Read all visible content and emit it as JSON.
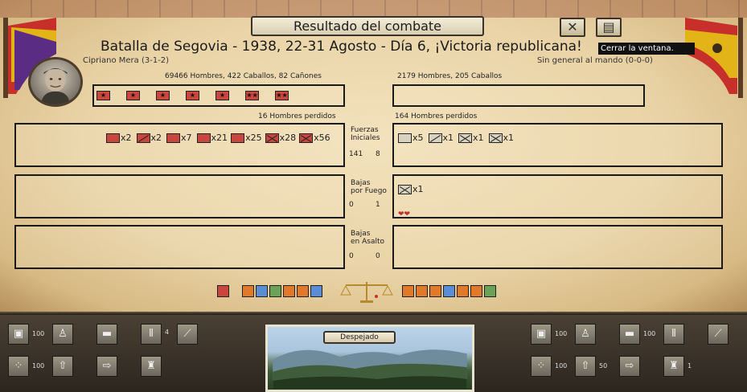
{
  "window": {
    "title": "Resultado del combate",
    "close_icon": "close-icon",
    "log_icon": "document-icon",
    "tooltip": "Cerrar la ventana."
  },
  "battle": {
    "title": "Batalla de Segovia - 1938, 22-31 Agosto - Día 6, ¡Victoria republicana!"
  },
  "left": {
    "general": "Cipriano Mera (3-1-2)",
    "strength": "69466 Hombres, 422 Caballos, 82 Cañones",
    "lost": "16 Hombres perdidos",
    "initial_units": [
      {
        "count": "x2"
      },
      {
        "count": "x2"
      },
      {
        "count": "x7"
      },
      {
        "count": "x21"
      },
      {
        "count": "x25"
      },
      {
        "count": "x28"
      },
      {
        "count": "x56"
      }
    ],
    "fire_losses": [],
    "assault_losses": [],
    "initial_stat": "141",
    "fire_stat": "0",
    "assault_stat": "0"
  },
  "right": {
    "general": "Sin general al mando (0-0-0)",
    "strength": "2179 Hombres, 205 Caballos",
    "lost": "164 Hombres perdidos",
    "initial_units": [
      {
        "count": "x5"
      },
      {
        "count": "x1"
      },
      {
        "count": "x1"
      },
      {
        "count": "x1"
      }
    ],
    "fire_losses": [
      {
        "count": "x1"
      }
    ],
    "initial_stat": "8",
    "fire_stat": "1",
    "assault_stat": "0"
  },
  "rows": {
    "initial": "Fuerzas\nIniciales",
    "fire": "Bajas\npor Fuego",
    "assault": "Bajas\nen Asalto"
  },
  "bottom": {
    "weather": "Despejado",
    "left_values": [
      "100",
      "4",
      "100"
    ],
    "right_values": [
      "100",
      "100",
      "100",
      "50",
      "1"
    ]
  },
  "colors": {
    "republic_red": "#c9463f",
    "parchment": "#e9d3a6"
  }
}
